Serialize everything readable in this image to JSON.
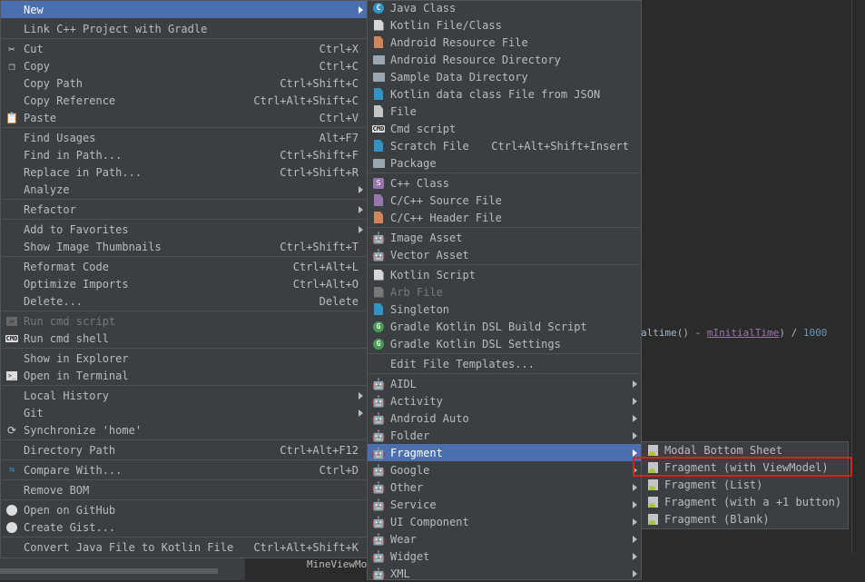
{
  "editor": {
    "code_part1": "altime() - ",
    "code_field": "mInitialTime",
    "code_part2": ") / ",
    "code_number": "1000"
  },
  "bottom": {
    "tab_label": "MineViewMo"
  },
  "menu1": {
    "new": "New",
    "link_cpp": "Link C++ Project with Gradle",
    "cut": "Cut",
    "cut_sc": "Ctrl+X",
    "copy": "Copy",
    "copy_sc": "Ctrl+C",
    "copy_path": "Copy Path",
    "copy_path_sc": "Ctrl+Shift+C",
    "copy_ref": "Copy Reference",
    "copy_ref_sc": "Ctrl+Alt+Shift+C",
    "paste": "Paste",
    "paste_sc": "Ctrl+V",
    "find_usages": "Find Usages",
    "find_usages_sc": "Alt+F7",
    "find_in_path": "Find in Path...",
    "find_in_path_sc": "Ctrl+Shift+F",
    "replace_in_path": "Replace in Path...",
    "replace_in_path_sc": "Ctrl+Shift+R",
    "analyze": "Analyze",
    "refactor": "Refactor",
    "add_fav": "Add to Favorites",
    "show_thumbs": "Show Image Thumbnails",
    "show_thumbs_sc": "Ctrl+Shift+T",
    "reformat": "Reformat Code",
    "reformat_sc": "Ctrl+Alt+L",
    "optimize": "Optimize Imports",
    "optimize_sc": "Ctrl+Alt+O",
    "delete": "Delete...",
    "delete_sc": "Delete",
    "run_cmd_script": "Run cmd script",
    "run_cmd_shell": "Run cmd shell",
    "show_explorer": "Show in Explorer",
    "open_terminal": "Open in Terminal",
    "local_history": "Local History",
    "git": "Git",
    "synchronize": "Synchronize 'home'",
    "dir_path": "Directory Path",
    "dir_path_sc": "Ctrl+Alt+F12",
    "compare": "Compare With...",
    "compare_sc": "Ctrl+D",
    "remove_bom": "Remove BOM",
    "open_github": "Open on GitHub",
    "create_gist": "Create Gist...",
    "convert": "Convert Java File to Kotlin File",
    "convert_sc": "Ctrl+Alt+Shift+K"
  },
  "menu2": {
    "java_class": "Java Class",
    "kotlin_file": "Kotlin File/Class",
    "android_res_file": "Android Resource File",
    "android_res_dir": "Android Resource Directory",
    "sample_data": "Sample Data Directory",
    "kotlin_json": "Kotlin data class File from JSON",
    "file": "File",
    "cmd_script": "Cmd script",
    "scratch": "Scratch File",
    "scratch_sc": "Ctrl+Alt+Shift+Insert",
    "package": "Package",
    "cpp_class": "C++ Class",
    "cpp_source": "C/C++ Source File",
    "cpp_header": "C/C++ Header File",
    "image_asset": "Image Asset",
    "vector_asset": "Vector Asset",
    "kotlin_script": "Kotlin Script",
    "arb_file": "Arb File",
    "singleton": "Singleton",
    "gradle_build": "Gradle Kotlin DSL Build Script",
    "gradle_settings": "Gradle Kotlin DSL Settings",
    "edit_templates": "Edit File Templates...",
    "aidl": "AIDL",
    "activity": "Activity",
    "android_auto": "Android Auto",
    "folder": "Folder",
    "fragment": "Fragment",
    "google": "Google",
    "other": "Other",
    "service": "Service",
    "ui_component": "UI Component",
    "wear": "Wear",
    "widget": "Widget",
    "xml": "XML"
  },
  "menu3": {
    "modal_bottom": "Modal Bottom Sheet",
    "frag_viewmodel": "Fragment (with ViewModel)",
    "frag_list": "Fragment (List)",
    "frag_plus1": "Fragment (with a +1 button)",
    "frag_blank": "Fragment (Blank)"
  },
  "colors": {
    "selection": "#4b6eaf",
    "menu_bg": "#3c3f41",
    "highlight_box": "#e31d1d",
    "android_green": "#a4c639"
  }
}
